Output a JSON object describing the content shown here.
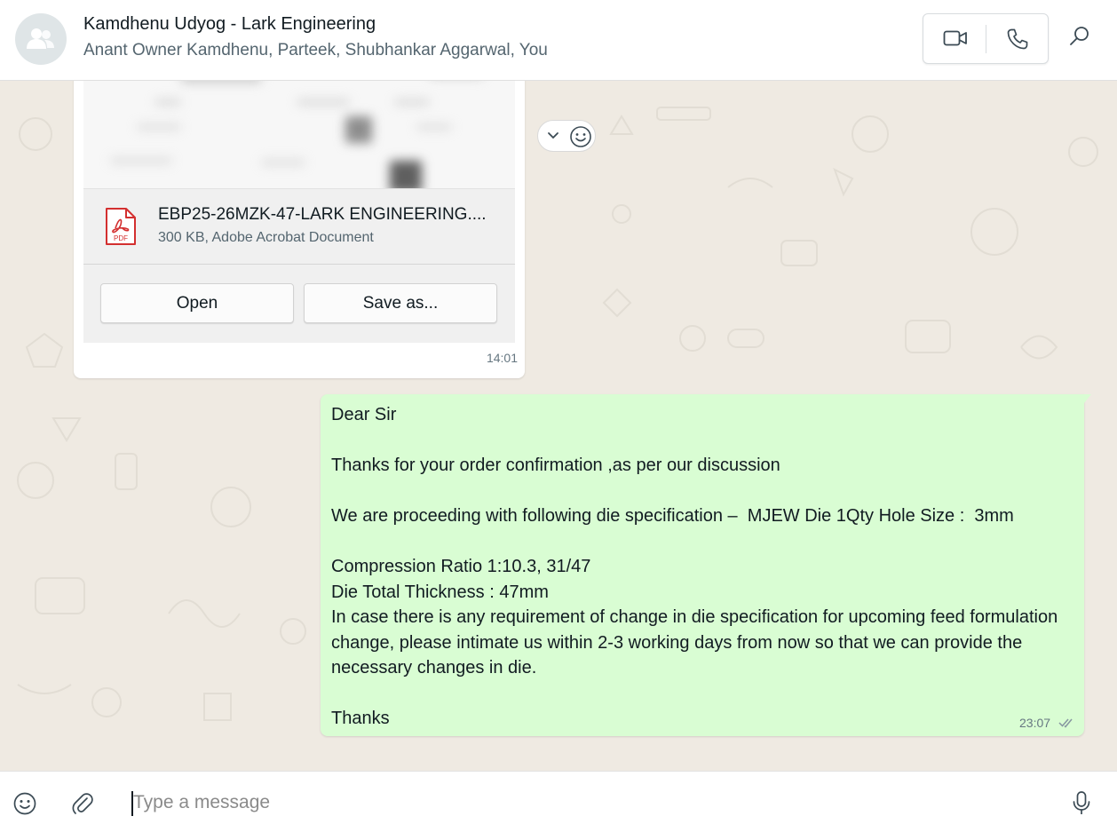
{
  "header": {
    "title": "Kamdhenu Udyog - Lark Engineering",
    "participants": "Anant Owner Kamdhenu, Parteek, Shubhankar Aggarwal, You",
    "avatar_icon": "group-icon",
    "video_call_icon": "video-camera-icon",
    "voice_call_icon": "phone-icon",
    "search_icon": "search-icon"
  },
  "document_message": {
    "file_name": "EBP25-26MZK-47-LARK ENGINEERING....",
    "file_meta": "300 KB, Adobe Acrobat Document",
    "file_type_icon": "pdf-icon",
    "open_label": "Open",
    "save_label": "Save as...",
    "time": "14:01"
  },
  "reaction_controls": {
    "menu_icon": "chevron-down-icon",
    "react_icon": "smiley-icon"
  },
  "outgoing_message": {
    "text": "Dear Sir\n\nThanks for your order confirmation ,as per our discussion\n\nWe are proceeding with following die specification –  MJEW Die 1Qty Hole Size :  3mm\n\nCompression Ratio 1:10.3, 31/47\nDie Total Thickness : 47mm\nIn case there is any requirement of change in die specification for upcoming feed formulation change, please intimate us within 2-3 working days from now so that we can provide the necessary changes in die.\n\nThanks",
    "time": "23:07",
    "status_icon": "double-check-icon"
  },
  "composer": {
    "placeholder": "Type a message",
    "value": "",
    "emoji_icon": "emoji-icon",
    "attach_icon": "paperclip-icon",
    "mic_icon": "microphone-icon"
  },
  "colors": {
    "outgoing_bubble": "#d9fdd3",
    "incoming_bubble": "#ffffff",
    "chat_background": "#efeae2",
    "pdf_red": "#d32f2f"
  }
}
